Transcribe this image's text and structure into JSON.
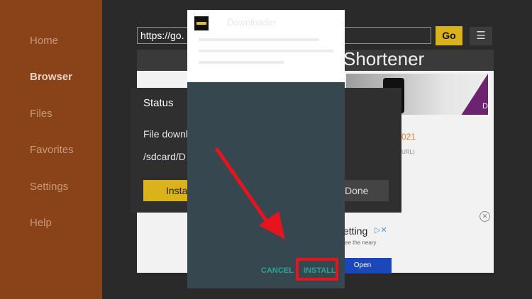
{
  "sidebar": {
    "items": [
      {
        "label": "Home",
        "active": false
      },
      {
        "label": "Browser",
        "active": true
      },
      {
        "label": "Files",
        "active": false
      },
      {
        "label": "Favorites",
        "active": false
      },
      {
        "label": "Settings",
        "active": false
      },
      {
        "label": "Help",
        "active": false
      }
    ]
  },
  "browser": {
    "url_value": "https://go.",
    "go_label": "Go",
    "menu_icon": "hamburger-menu-icon",
    "headline": "Shortener",
    "page_date": "021",
    "page_small": "URL)",
    "hero_letter": "D"
  },
  "status_dialog": {
    "title": "Status",
    "line1": "File downl",
    "line2": "/sdcard/D",
    "install_label": "Insta",
    "done_label": "Done"
  },
  "ad": {
    "close_icon": "close-circle-icon",
    "title": "etting",
    "choices": "▷✕",
    "sub": "ee the neary",
    "open_label": "Open"
  },
  "installer": {
    "app_name": "Downloader",
    "cancel_label": "CANCEL",
    "install_label": "INSTALL"
  },
  "colors": {
    "sidebar": "#8a4218",
    "accent_yellow": "#d9b21c",
    "installer_bg": "#37474f",
    "teal_text": "#26a69a",
    "highlight_red": "#e8141d"
  }
}
